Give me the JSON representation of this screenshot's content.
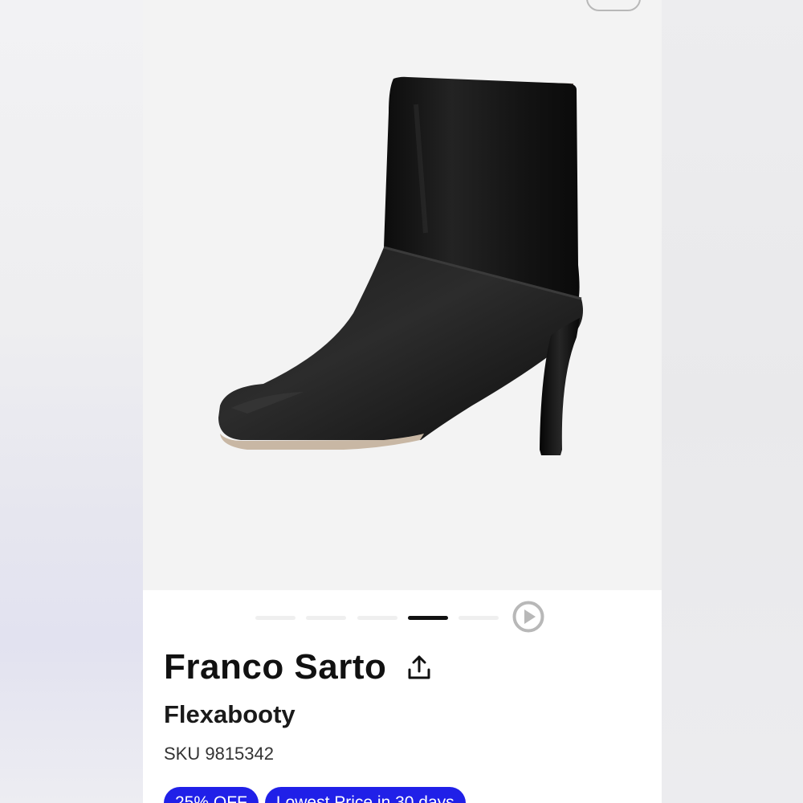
{
  "product": {
    "brand": "Franco Sarto",
    "name": "Flexabooty",
    "sku": "SKU 9815342"
  },
  "gallery": {
    "image_alt": "Black leather ankle boot with square toe and heel",
    "slide_count": 5,
    "active_slide": 4,
    "play_icon": "play-circle-icon"
  },
  "actions": {
    "share_icon": "share-upload-icon"
  },
  "badges": [
    {
      "label": "25% OFF"
    },
    {
      "label": "Lowest Price in 30 days"
    }
  ],
  "colors": {
    "accent": "#2020e8",
    "text": "#111111",
    "hero_bg": "#f3f3f3",
    "boot": "#141414"
  }
}
